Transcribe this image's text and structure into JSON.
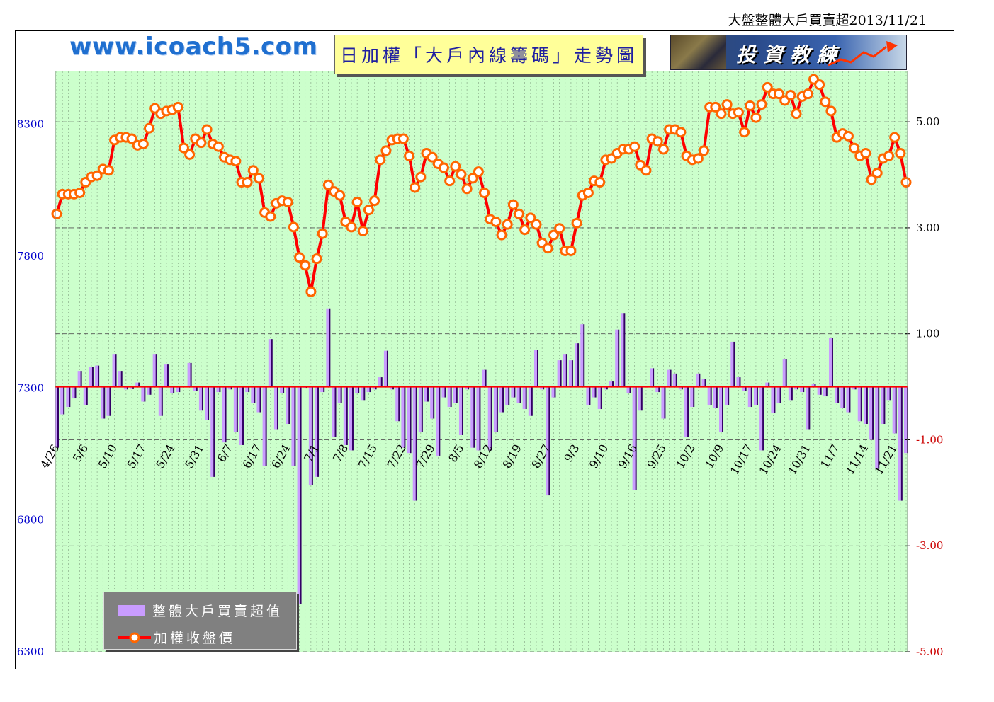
{
  "header": {
    "caption": "大盤整體大戶買賣超2013/11/21",
    "website": "www.icoach5.com",
    "title": "日加權「大戶內線籌碼」走勢圖",
    "banner_text": "投資教練"
  },
  "legend": {
    "bar_label": "整體大戶買賣超值",
    "line_label": "加權收盤價"
  },
  "colors": {
    "plot_bg": "#ccffcc",
    "line": "#ff0000",
    "marker_fill": "#ffffff",
    "marker_edge": "#ff6600",
    "bar": "#c99cff",
    "bar_shadow": "#330066",
    "left_axis_text": "#0000cc",
    "right_axis_text": "#000000",
    "right_axis_neg_text": "#cc0000"
  },
  "chart_data": {
    "type": "bar+line",
    "left_axis": {
      "label": "",
      "ylim": [
        6300,
        8500
      ],
      "ticks": [
        6300,
        6800,
        7300,
        7800,
        8300
      ]
    },
    "right_axis": {
      "label": "",
      "ylim": [
        -5,
        5.95
      ],
      "ticks": [
        "5.00",
        "3.00",
        "1.00",
        "-1.00",
        "-3.00",
        "-5.00"
      ],
      "tick_values": [
        5,
        3,
        1,
        -1,
        -3,
        -5
      ]
    },
    "x_tick_labels": [
      "4/26",
      "5/6",
      "5/10",
      "5/17",
      "5/24",
      "5/31",
      "6/7",
      "6/17",
      "6/24",
      "7/1",
      "7/8",
      "7/15",
      "7/22",
      "7/29",
      "8/5",
      "8/12",
      "8/19",
      "8/27",
      "9/3",
      "9/10",
      "9/16",
      "9/25",
      "10/2",
      "10/9",
      "10/17",
      "10/24",
      "10/31",
      "11/7",
      "11/14",
      "11/21"
    ],
    "x_tick_index": [
      0,
      5,
      10,
      15,
      20,
      25,
      30,
      35,
      40,
      45,
      50,
      55,
      60,
      65,
      70,
      75,
      80,
      85,
      90,
      95,
      100,
      105,
      110,
      115,
      120,
      125,
      130,
      135,
      140,
      145
    ],
    "grid": true,
    "legend_position": "bottom-left",
    "series": [
      {
        "name": "整體大戶買賣超值",
        "type": "bar",
        "axis": "right",
        "values": [
          -1.15,
          -0.52,
          -0.38,
          -0.22,
          0.3,
          -0.35,
          0.38,
          0.4,
          -0.6,
          -0.55,
          0.62,
          0.3,
          -0.05,
          -0.03,
          0.08,
          -0.28,
          -0.15,
          0.62,
          -0.55,
          0.42,
          -0.12,
          -0.1,
          0.02,
          0.45,
          -0.08,
          -0.45,
          -0.62,
          -1.7,
          -0.1,
          -1.05,
          -0.05,
          -0.85,
          -1.1,
          -0.1,
          -0.3,
          -0.48,
          -1.5,
          0.9,
          -0.8,
          -0.12,
          -0.7,
          -1.5,
          -4.1,
          -0.02,
          -1.85,
          -1.7,
          -0.1,
          1.48,
          -0.95,
          -0.3,
          -1.1,
          -1.2,
          -0.12,
          -0.25,
          -0.1,
          -0.05,
          0.18,
          0.68,
          -0.05,
          -0.65,
          -1.15,
          -1.25,
          -2.15,
          -0.85,
          -0.28,
          -0.6,
          -1.3,
          -0.2,
          -0.38,
          -0.3,
          -0.9,
          -0.05,
          -1.15,
          -1.2,
          0.32,
          -1.2,
          -0.85,
          -0.48,
          -0.35,
          -0.2,
          -0.3,
          -0.42,
          -0.55,
          0.7,
          -0.05,
          -2.05,
          -0.2,
          0.5,
          0.62,
          0.5,
          0.82,
          1.18,
          -0.35,
          -0.2,
          -0.42,
          -0.05,
          0.1,
          1.08,
          1.38,
          -0.12,
          -1.95,
          -0.45,
          0.0,
          0.35,
          -0.1,
          -0.6,
          0.32,
          0.25,
          -0.05,
          -0.95,
          -0.38,
          0.25,
          0.15,
          -0.35,
          -0.4,
          -0.85,
          -0.35,
          0.85,
          0.18,
          -0.08,
          -0.38,
          -0.35,
          -1.2,
          0.08,
          -0.5,
          -0.3,
          0.52,
          -0.25,
          -0.05,
          -0.1,
          -0.8,
          0.05,
          -0.15,
          -0.18,
          0.92,
          -0.3,
          -0.4,
          -0.48,
          -0.05,
          -0.65,
          -0.7,
          -1.0,
          -1.55,
          -0.7,
          -0.25,
          -0.88,
          -2.15,
          -1.25
        ]
      },
      {
        "name": "加權收盤價",
        "type": "line",
        "axis": "left",
        "values": [
          7960,
          8035,
          8035,
          8035,
          8040,
          8080,
          8100,
          8105,
          8130,
          8125,
          8240,
          8250,
          8250,
          8245,
          8220,
          8225,
          8285,
          8360,
          8340,
          8350,
          8355,
          8365,
          8210,
          8185,
          8245,
          8230,
          8280,
          8225,
          8215,
          8175,
          8165,
          8160,
          8080,
          8080,
          8125,
          8095,
          7965,
          7950,
          8000,
          8010,
          8005,
          7910,
          7795,
          7765,
          7665,
          7790,
          7885,
          8070,
          8045,
          8030,
          7930,
          7910,
          8005,
          7895,
          7975,
          8010,
          8165,
          8200,
          8240,
          8245,
          8245,
          8180,
          8060,
          8100,
          8190,
          8175,
          8150,
          8135,
          8085,
          8140,
          8110,
          8055,
          8095,
          8120,
          8040,
          7940,
          7930,
          7880,
          7920,
          7995,
          7960,
          7900,
          7945,
          7920,
          7850,
          7830,
          7880,
          7905,
          7820,
          7820,
          7925,
          8030,
          8040,
          8085,
          8080,
          8165,
          8170,
          8190,
          8205,
          8205,
          8215,
          8145,
          8125,
          8245,
          8235,
          8205,
          8280,
          8280,
          8270,
          8180,
          8165,
          8170,
          8200,
          8365,
          8365,
          8340,
          8375,
          8340,
          8345,
          8270,
          8370,
          8325,
          8375,
          8440,
          8415,
          8415,
          8390,
          8410,
          8340,
          8405,
          8415,
          8470,
          8450,
          8385,
          8350,
          8250,
          8265,
          8255,
          8210,
          8180,
          8190,
          8090,
          8115,
          8170,
          8180,
          8250,
          8190,
          8080
        ]
      }
    ]
  }
}
